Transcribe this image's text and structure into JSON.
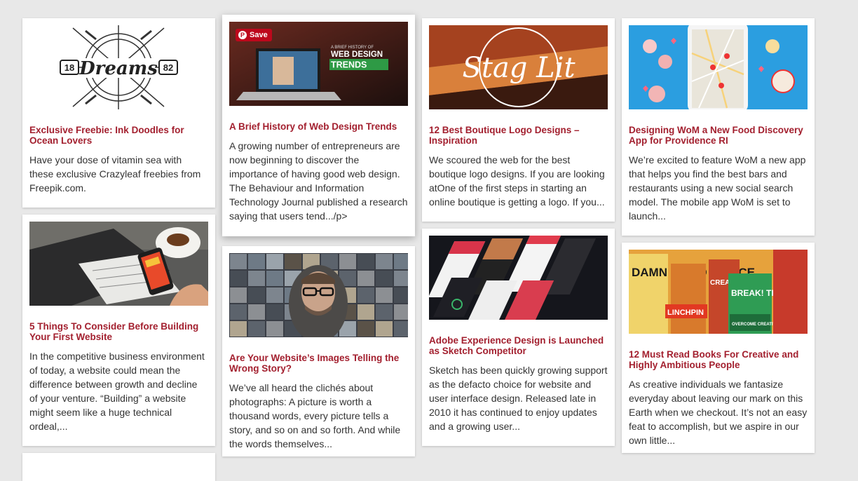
{
  "pin_button": {
    "label": "Save"
  },
  "columns": [
    [
      {
        "title": "Exclusive Freebie: Ink Doodles for Ocean Lovers",
        "excerpt": "Have your dose of vitamin sea with these exclusive Crazyleaf freebies from Freepik.com.",
        "thumb": {
          "type": "dreams",
          "left_number": "18",
          "word": "Dreams",
          "right_number": "82"
        }
      },
      {
        "title": "5 Things To Consider Before Building Your First Website",
        "excerpt": "In the competitive business environment of today, a website could mean the difference between growth and decline of your venture. “Building” a website might seem like a huge technical ordeal,...",
        "thumb": {
          "type": "desk"
        }
      }
    ],
    [
      {
        "title": "A Brief History of Web Design Trends",
        "excerpt": "A growing number of entrepreneurs are now beginning to discover the importance of having good web design. The Behaviour and Information Technology Journal published a research saying that users tend.../p>",
        "thumb": {
          "type": "webdesign",
          "line1": "A BRIEF HISTORY OF",
          "line2": "WEB DESIGN",
          "line3": "TRENDS"
        },
        "hovered": true
      },
      {
        "title": "Are Your Website’s Images Telling the Wrong Story?",
        "excerpt": "We’ve all heard the clichés about photographs: A picture is worth a thousand words, every picture tells a story, and so on and so forth. And while the words themselves...",
        "thumb": {
          "type": "photos"
        }
      }
    ],
    [
      {
        "title": "12 Best Boutique Logo Designs – Inspiration",
        "excerpt": "We scoured the web for the best boutique logo designs. If you are looking atOne of the first steps in starting an online boutique is getting a logo. If you...",
        "thumb": {
          "type": "staglit",
          "word": "Stag Lit"
        }
      },
      {
        "title": "Adobe Experience Design is Launched as Sketch Competitor",
        "excerpt": "Sketch has been quickly growing support as the defacto choice for website and user interface design. Released late in 2010 it has continued to enjoy updates and a growing user...",
        "thumb": {
          "type": "screens"
        }
      }
    ],
    [
      {
        "title": "Designing WoM a New Food Discovery App for Providence RI",
        "excerpt": "We’re excited to feature WoM a new app that helps you find the best bars and restaurants using a new social search model. The mobile app WoM is set to launch...",
        "thumb": {
          "type": "map"
        }
      },
      {
        "title": "12 Must Read Books For Creative and Highly Ambitious People",
        "excerpt": "As creative individuals we fantasize everyday about leaving our mark on this Earth when we checkout. It’s not an easy feat to accomplish, but we aspire in our own little...",
        "thumb": {
          "type": "books",
          "b1": "DAMN GOOD ADVICE",
          "b2": "LINCHPIN",
          "b3": "CREATIVE",
          "b4": "BREAK! THROUGH",
          "b5": "OVERCOME CREATIVE BLOCK"
        }
      }
    ]
  ]
}
